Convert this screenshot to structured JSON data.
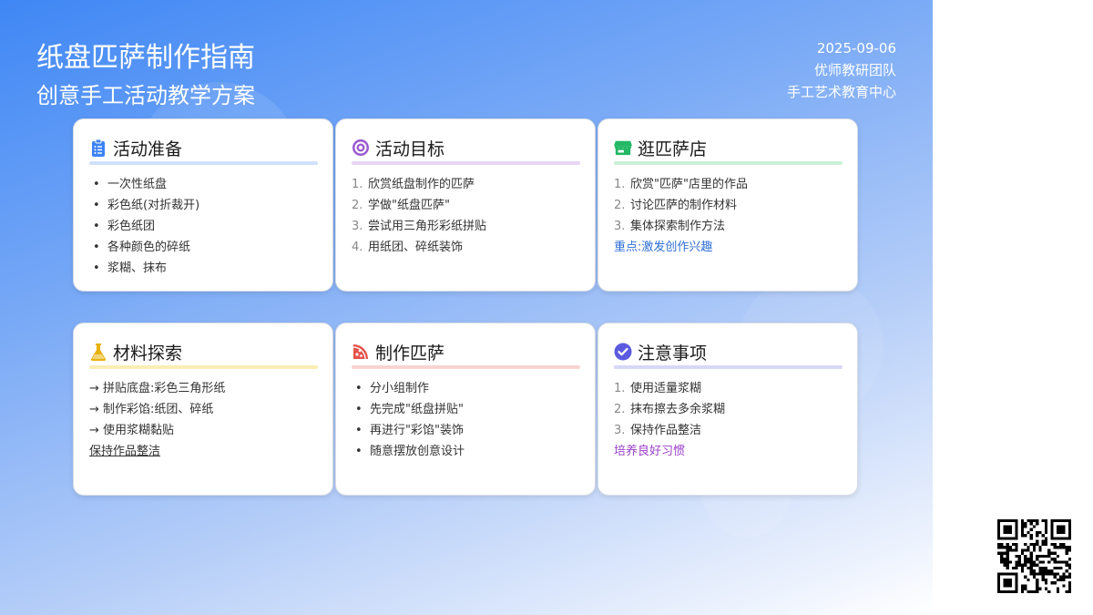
{
  "header": {
    "title": "纸盘匹萨制作指南",
    "subtitle": "创意手工活动教学方案",
    "date": "2025-09-06",
    "team": "优师教研团队",
    "org": "手工艺术教育中心"
  },
  "cards": [
    {
      "title": "活动准备",
      "icon": "clipboard-list-icon",
      "accent": "#3b82f6",
      "underline": "#cfe0fb",
      "list_style": "bullet",
      "items": [
        "一次性纸盘",
        "彩色纸(对折裁开)",
        "彩色纸团",
        "各种颜色的碎纸",
        "浆糊、抹布"
      ]
    },
    {
      "title": "活动目标",
      "icon": "target-icon",
      "accent": "#9b59d0",
      "underline": "#e6d6f5",
      "list_style": "numbered",
      "items": [
        "欣赏纸盘制作的匹萨",
        "学做\"纸盘匹萨\"",
        "尝试用三角形彩纸拼贴",
        "用纸团、碎纸装饰"
      ]
    },
    {
      "title": "逛匹萨店",
      "icon": "store-icon",
      "accent": "#22b864",
      "underline": "#c9f0d7",
      "list_style": "numbered",
      "items": [
        "欣赏\"匹萨\"店里的作品",
        "讨论匹萨的制作材料",
        "集体探索制作方法"
      ],
      "note": "重点:激发创作兴趣",
      "note_color": "#2f6fd6"
    },
    {
      "title": "材料探索",
      "icon": "flask-icon",
      "accent": "#e8b20c",
      "underline": "#fbedb3",
      "list_style": "arrow",
      "items": [
        "→ 拼贴底盘:彩色三角形纸",
        "→ 制作彩馅:纸团、碎纸",
        "→ 使用浆糊黏贴"
      ],
      "note": "保持作品整洁",
      "note_color": "#333333"
    },
    {
      "title": "制作匹萨",
      "icon": "pizza-slice-icon",
      "accent": "#e5534b",
      "underline": "#f8d3d1",
      "list_style": "bullet",
      "items": [
        "分小组制作",
        "先完成\"纸盘拼贴\"",
        "再进行\"彩馅\"装饰",
        "随意摆放创意设计"
      ]
    },
    {
      "title": "注意事项",
      "icon": "check-circle-icon",
      "accent": "#5b5be0",
      "underline": "#d7d7f7",
      "list_style": "numbered",
      "items": [
        "使用适量浆糊",
        "抹布擦去多余浆糊",
        "保持作品整洁"
      ],
      "note": "培养良好习惯",
      "note_color": "#9b3fc9"
    }
  ],
  "qr": {
    "icon": "qr-code-icon"
  }
}
